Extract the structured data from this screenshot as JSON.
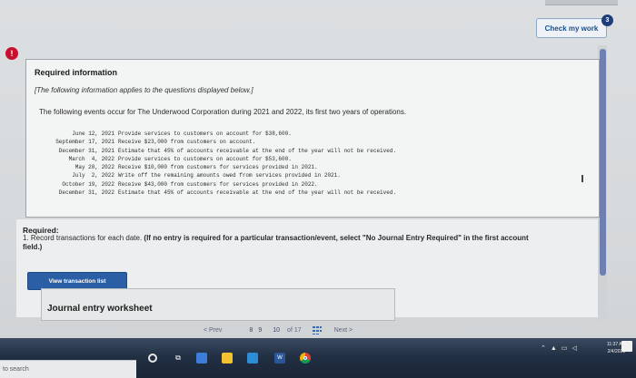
{
  "header": {
    "check_label": "Check my work",
    "check_badge": "3"
  },
  "alert": {
    "icon": "exclamation-icon",
    "glyph": "!"
  },
  "info": {
    "title": "Required information",
    "note": "[The following information applies to the questions displayed below.]",
    "description": "The following events occur for The Underwood Corporation during 2021 and 2022, its first two years of operations.",
    "events": [
      {
        "date": "June 12, 2021",
        "text": "Provide services to customers on account for $38,600."
      },
      {
        "date": "September 17, 2021",
        "text": "Receive $23,000 from customers on account."
      },
      {
        "date": "December 31, 2021",
        "text": "Estimate that 45% of accounts receivable at the end of the year will not be received."
      },
      {
        "date": "March  4, 2022",
        "text": "Provide services to customers on account for $53,600."
      },
      {
        "date": "May 20, 2022",
        "text": "Receive $10,000 from customers for services provided in 2021."
      },
      {
        "date": "July  2, 2022",
        "text": "Write off the remaining amounts owed from services provided in 2021."
      },
      {
        "date": "October 19, 2022",
        "text": "Receive $43,000 from customers for services provided in 2022."
      },
      {
        "date": "December 31, 2022",
        "text": "Estimate that 45% of accounts receivable at the end of the year will not be received."
      }
    ]
  },
  "required": {
    "title": "Required:",
    "text_plain": "1. Record transactions for each date.",
    "text_bold": "(If no entry is required for a particular transaction/event, select \"No Journal Entry Required\" in the first account field.)",
    "view_button": "View transaction list",
    "worksheet_title": "Journal entry worksheet"
  },
  "pager": {
    "prev": "< Prev",
    "page_a": "8",
    "page_b": "9",
    "page_c": "10",
    "of": "of 17",
    "next": "Next >"
  },
  "taskbar": {
    "search_placeholder": "to search",
    "time": "11:37 AM",
    "date": "2/4/2021",
    "tray_icons": [
      "chevron-up-icon",
      "network-icon",
      "battery-icon",
      "volume-icon"
    ]
  },
  "colors": {
    "accent_blue": "#2b5fa5",
    "alert_red": "#c8102e",
    "badge_navy": "#1f3d78"
  }
}
